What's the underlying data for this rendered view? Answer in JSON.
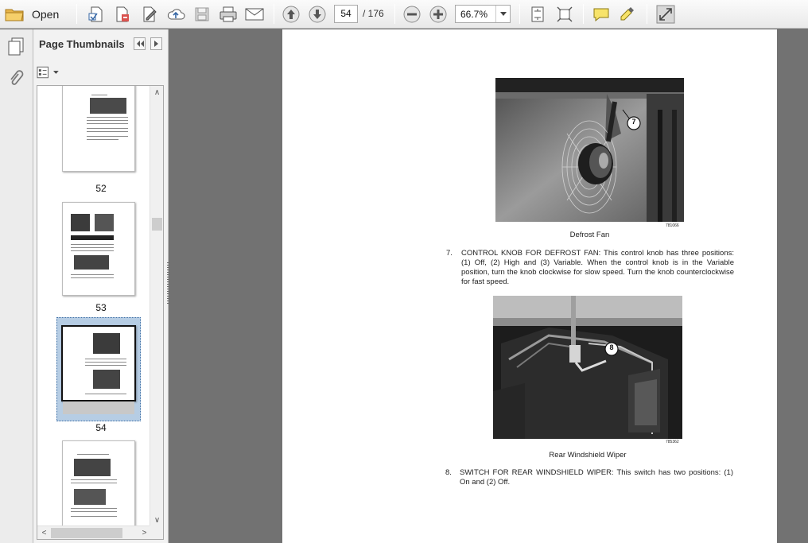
{
  "toolbar": {
    "open_label": "Open",
    "current_page": "54",
    "page_total": "/ 176",
    "zoom": "66.7%",
    "icons": [
      "folder-icon",
      "create-pdf-icon",
      "edit-pdf-icon",
      "sign-icon",
      "upload-cloud-icon",
      "save-icon",
      "print-icon",
      "email-icon",
      "previous-page-icon",
      "next-page-icon",
      "zoom-out-icon",
      "zoom-in-icon",
      "fit-page-icon",
      "full-screen-icon",
      "comment-icon",
      "highlight-icon",
      "expand-icon"
    ]
  },
  "sidebar": {
    "title": "Page Thumbnails",
    "thumbnails": [
      {
        "label": "52"
      },
      {
        "label": "53"
      },
      {
        "label": "54",
        "selected": true
      },
      {
        "label": ""
      }
    ]
  },
  "document": {
    "figure1": {
      "id": "781066",
      "caption": "Defrost Fan",
      "callout": "7"
    },
    "item7": {
      "number": "7.",
      "text": "CONTROL KNOB FOR DEFROST FAN:  This control knob has three positions:  (1) Off, (2) High and (3) Variable. When the control knob is in the Variable position, turn the knob clockwise for slow speed. Turn the knob counterclockwise for fast speed."
    },
    "figure2": {
      "id": "785362",
      "caption": "Rear Windshield Wiper",
      "callout": "8"
    },
    "item8": {
      "number": "8.",
      "text": "SWITCH FOR REAR WINDSHIELD WIPER:  This switch has two positions: (1) On and (2) Off."
    }
  }
}
